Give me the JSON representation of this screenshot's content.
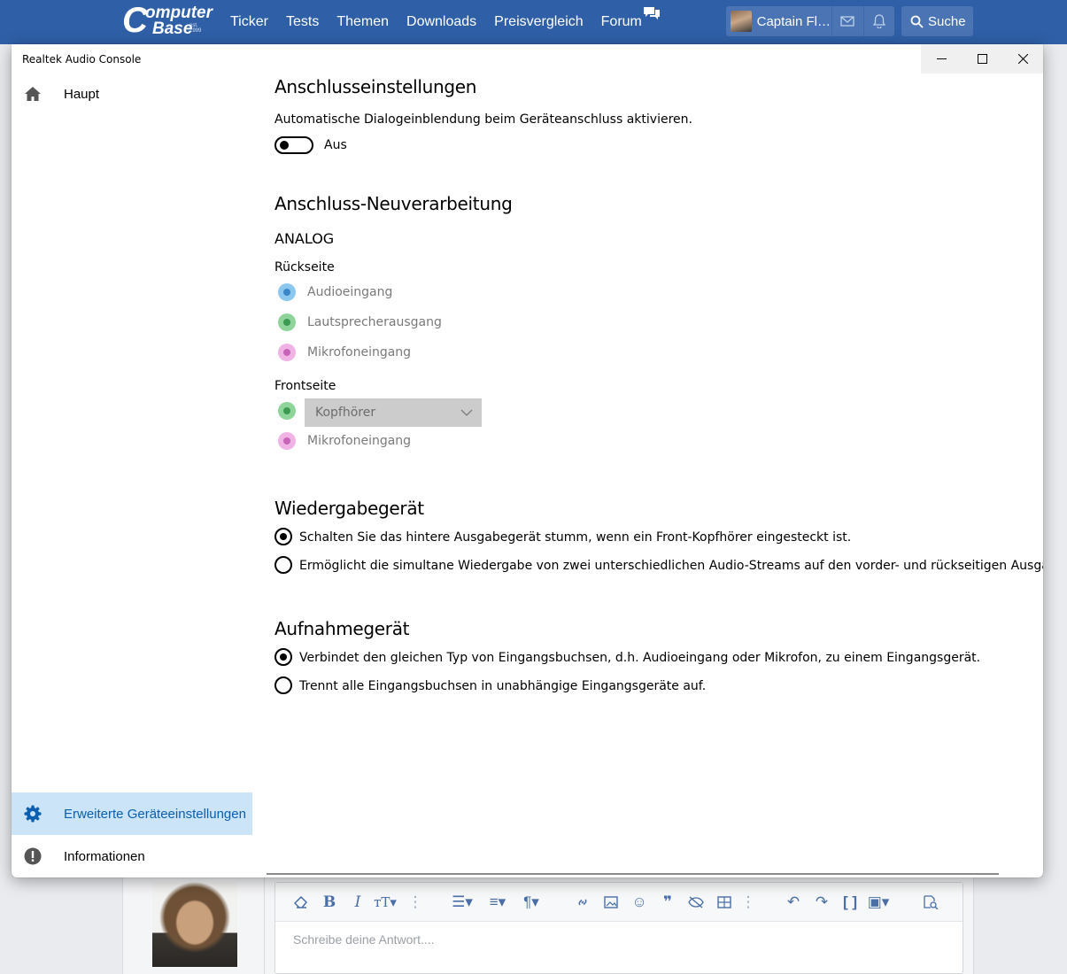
{
  "site": {
    "logo_c": "C",
    "logo_word1": "omputer",
    "logo_word2": "Base",
    "logo_est": "est. 1999",
    "nav": [
      "Ticker",
      "Tests",
      "Themen",
      "Downloads",
      "Preisvergleich",
      "Forum"
    ],
    "user_name": "Captain Fl…",
    "search_label": "Suche",
    "editor_placeholder": "Schreibe deine Antwort...."
  },
  "window": {
    "title": "Realtek Audio Console"
  },
  "sidebar": {
    "items": [
      {
        "label": "Haupt",
        "icon": "home-icon"
      },
      {
        "label": "Erweiterte Geräteeinstellungen",
        "icon": "gear-icon",
        "active": true
      },
      {
        "label": "Informationen",
        "icon": "info-icon"
      }
    ]
  },
  "content": {
    "connection": {
      "heading": "Anschlusseinstellungen",
      "description": "Automatische Dialogeinblendung beim Geräteanschluss aktivieren.",
      "toggle_state": "Aus"
    },
    "retasking": {
      "heading": "Anschluss-Neuverarbeitung",
      "analog": "ANALOG",
      "rear": {
        "label": "Rückseite",
        "jacks": [
          "Audioeingang",
          "Lautsprecherausgang",
          "Mikrofoneingang"
        ]
      },
      "front": {
        "label": "Frontseite",
        "dropdown_value": "Kopfhörer",
        "jack": "Mikrofoneingang"
      }
    },
    "playback": {
      "heading": "Wiedergabegerät",
      "options": [
        {
          "label": "Schalten Sie das hintere Ausgabegerät stumm, wenn ein Front-Kopfhörer eingesteckt ist.",
          "selected": true
        },
        {
          "label": "Ermöglicht die simultane Wiedergabe von zwei unterschiedlichen Audio-Streams auf den vorder- und rückseitigen Ausgangsgeräten.",
          "selected": false
        }
      ]
    },
    "recording": {
      "heading": "Aufnahmegerät",
      "options": [
        {
          "label": "Verbindet den gleichen Typ von Eingangsbuchsen, d.h. Audioeingang oder Mikrofon, zu einem Eingangsgerät.",
          "selected": true
        },
        {
          "label": "Trennt alle Eingangsbuchsen in unabhängige Eingangsgeräte auf.",
          "selected": false
        }
      ]
    }
  },
  "colors": {
    "site_header": "#2f5fa6",
    "active_sidebar_bg": "#cce4f7",
    "active_sidebar_text": "#0a5fb0",
    "jack_blue": "#8cc8ee",
    "jack_green": "#8fd49a",
    "jack_pink": "#f0b3e6"
  }
}
